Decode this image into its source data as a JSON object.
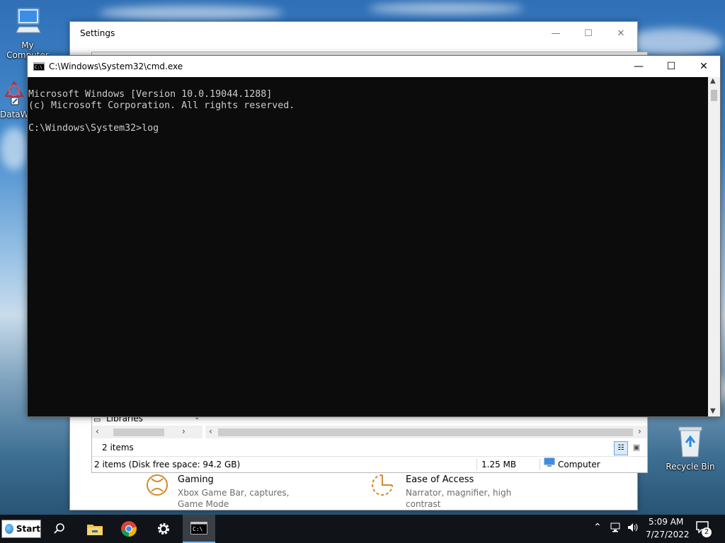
{
  "desktop": {
    "icons": [
      {
        "label": "My Computer",
        "icon": "monitor-icon"
      },
      {
        "label": "DataW",
        "icon": "datawindow-icon"
      },
      {
        "label": "Recycle Bin",
        "icon": "recycle-bin-icon"
      }
    ]
  },
  "settings_window": {
    "title": "Settings",
    "items": [
      {
        "name": "Gaming",
        "description": "Xbox Game Bar, captures, Game Mode",
        "icon": "xbox-icon"
      },
      {
        "name": "Ease of Access",
        "description": "Narrator, magnifier, high contrast",
        "icon": "ease-of-access-icon"
      }
    ]
  },
  "explorer_window": {
    "nav_item": "Libraries",
    "items_count": "2 items",
    "status": {
      "summary": "2 items (Disk free space: 94.2 GB)",
      "size": "1.25 MB",
      "location": "Computer"
    }
  },
  "cmd_window": {
    "title": "C:\\Windows\\System32\\cmd.exe",
    "lines": [
      "Microsoft Windows [Version 10.0.19044.1288]",
      "(c) Microsoft Corporation. All rights reserved.",
      "",
      "C:\\Windows\\System32>log"
    ]
  },
  "taskbar": {
    "start_label": "Start",
    "pinned": [
      {
        "name": "search",
        "icon": "search-icon"
      },
      {
        "name": "file-explorer",
        "icon": "folder-icon"
      },
      {
        "name": "chrome",
        "icon": "chrome-icon"
      },
      {
        "name": "settings",
        "icon": "gear-icon"
      },
      {
        "name": "command-prompt",
        "icon": "terminal-icon"
      }
    ],
    "clock": {
      "time": "5:09 AM",
      "date": "7/27/2022"
    },
    "notification_count": "2"
  },
  "colors": {
    "console_bg": "#0c0c0c",
    "console_text": "#cccccc",
    "taskbar_bg": "#101418",
    "accent_orange": "#d28a2e"
  }
}
